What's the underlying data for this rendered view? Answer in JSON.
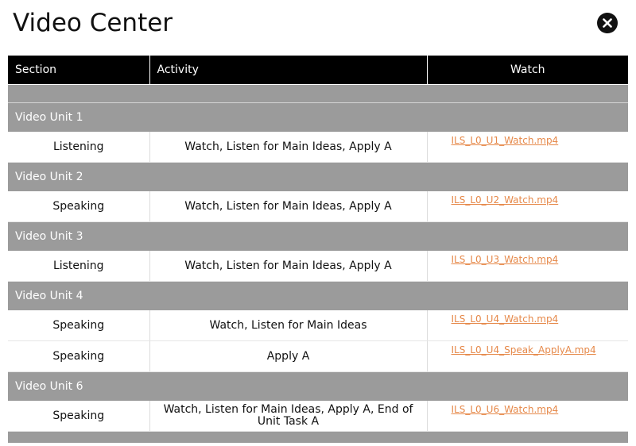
{
  "window": {
    "title": "Video Center"
  },
  "table": {
    "headers": [
      "Section",
      "Activity",
      "Watch"
    ],
    "units": [
      {
        "name": "Video Unit 1",
        "rows": [
          {
            "section": "Listening",
            "activity": "Watch, Listen for Main Ideas, Apply A",
            "file": "ILS_L0_U1_Watch.mp4"
          }
        ]
      },
      {
        "name": "Video Unit 2",
        "rows": [
          {
            "section": "Speaking",
            "activity": "Watch, Listen for Main Ideas, Apply A",
            "file": "ILS_L0_U2_Watch.mp4"
          }
        ]
      },
      {
        "name": "Video Unit 3",
        "rows": [
          {
            "section": "Listening",
            "activity": "Watch, Listen for Main Ideas, Apply A",
            "file": "ILS_L0_U3_Watch.mp4"
          }
        ]
      },
      {
        "name": "Video Unit 4",
        "rows": [
          {
            "section": "Speaking",
            "activity": "Watch, Listen for Main Ideas",
            "file": "ILS_L0_U4_Watch.mp4"
          },
          {
            "section": "Speaking",
            "activity": "Apply A",
            "file": "ILS_L0_U4_Speak_ApplyA.mp4"
          }
        ]
      },
      {
        "name": "Video Unit 6",
        "rows": [
          {
            "section": "Speaking",
            "activity": "Watch, Listen for Main Ideas, Apply A, End of Unit Task A",
            "file": "ILS_L0_U6_Watch.mp4"
          }
        ]
      }
    ]
  },
  "colors": {
    "header_bg": "#000000",
    "unit_bg": "#9b9b9b",
    "link": "#e6894a"
  },
  "icons": {
    "close": "close-icon"
  }
}
